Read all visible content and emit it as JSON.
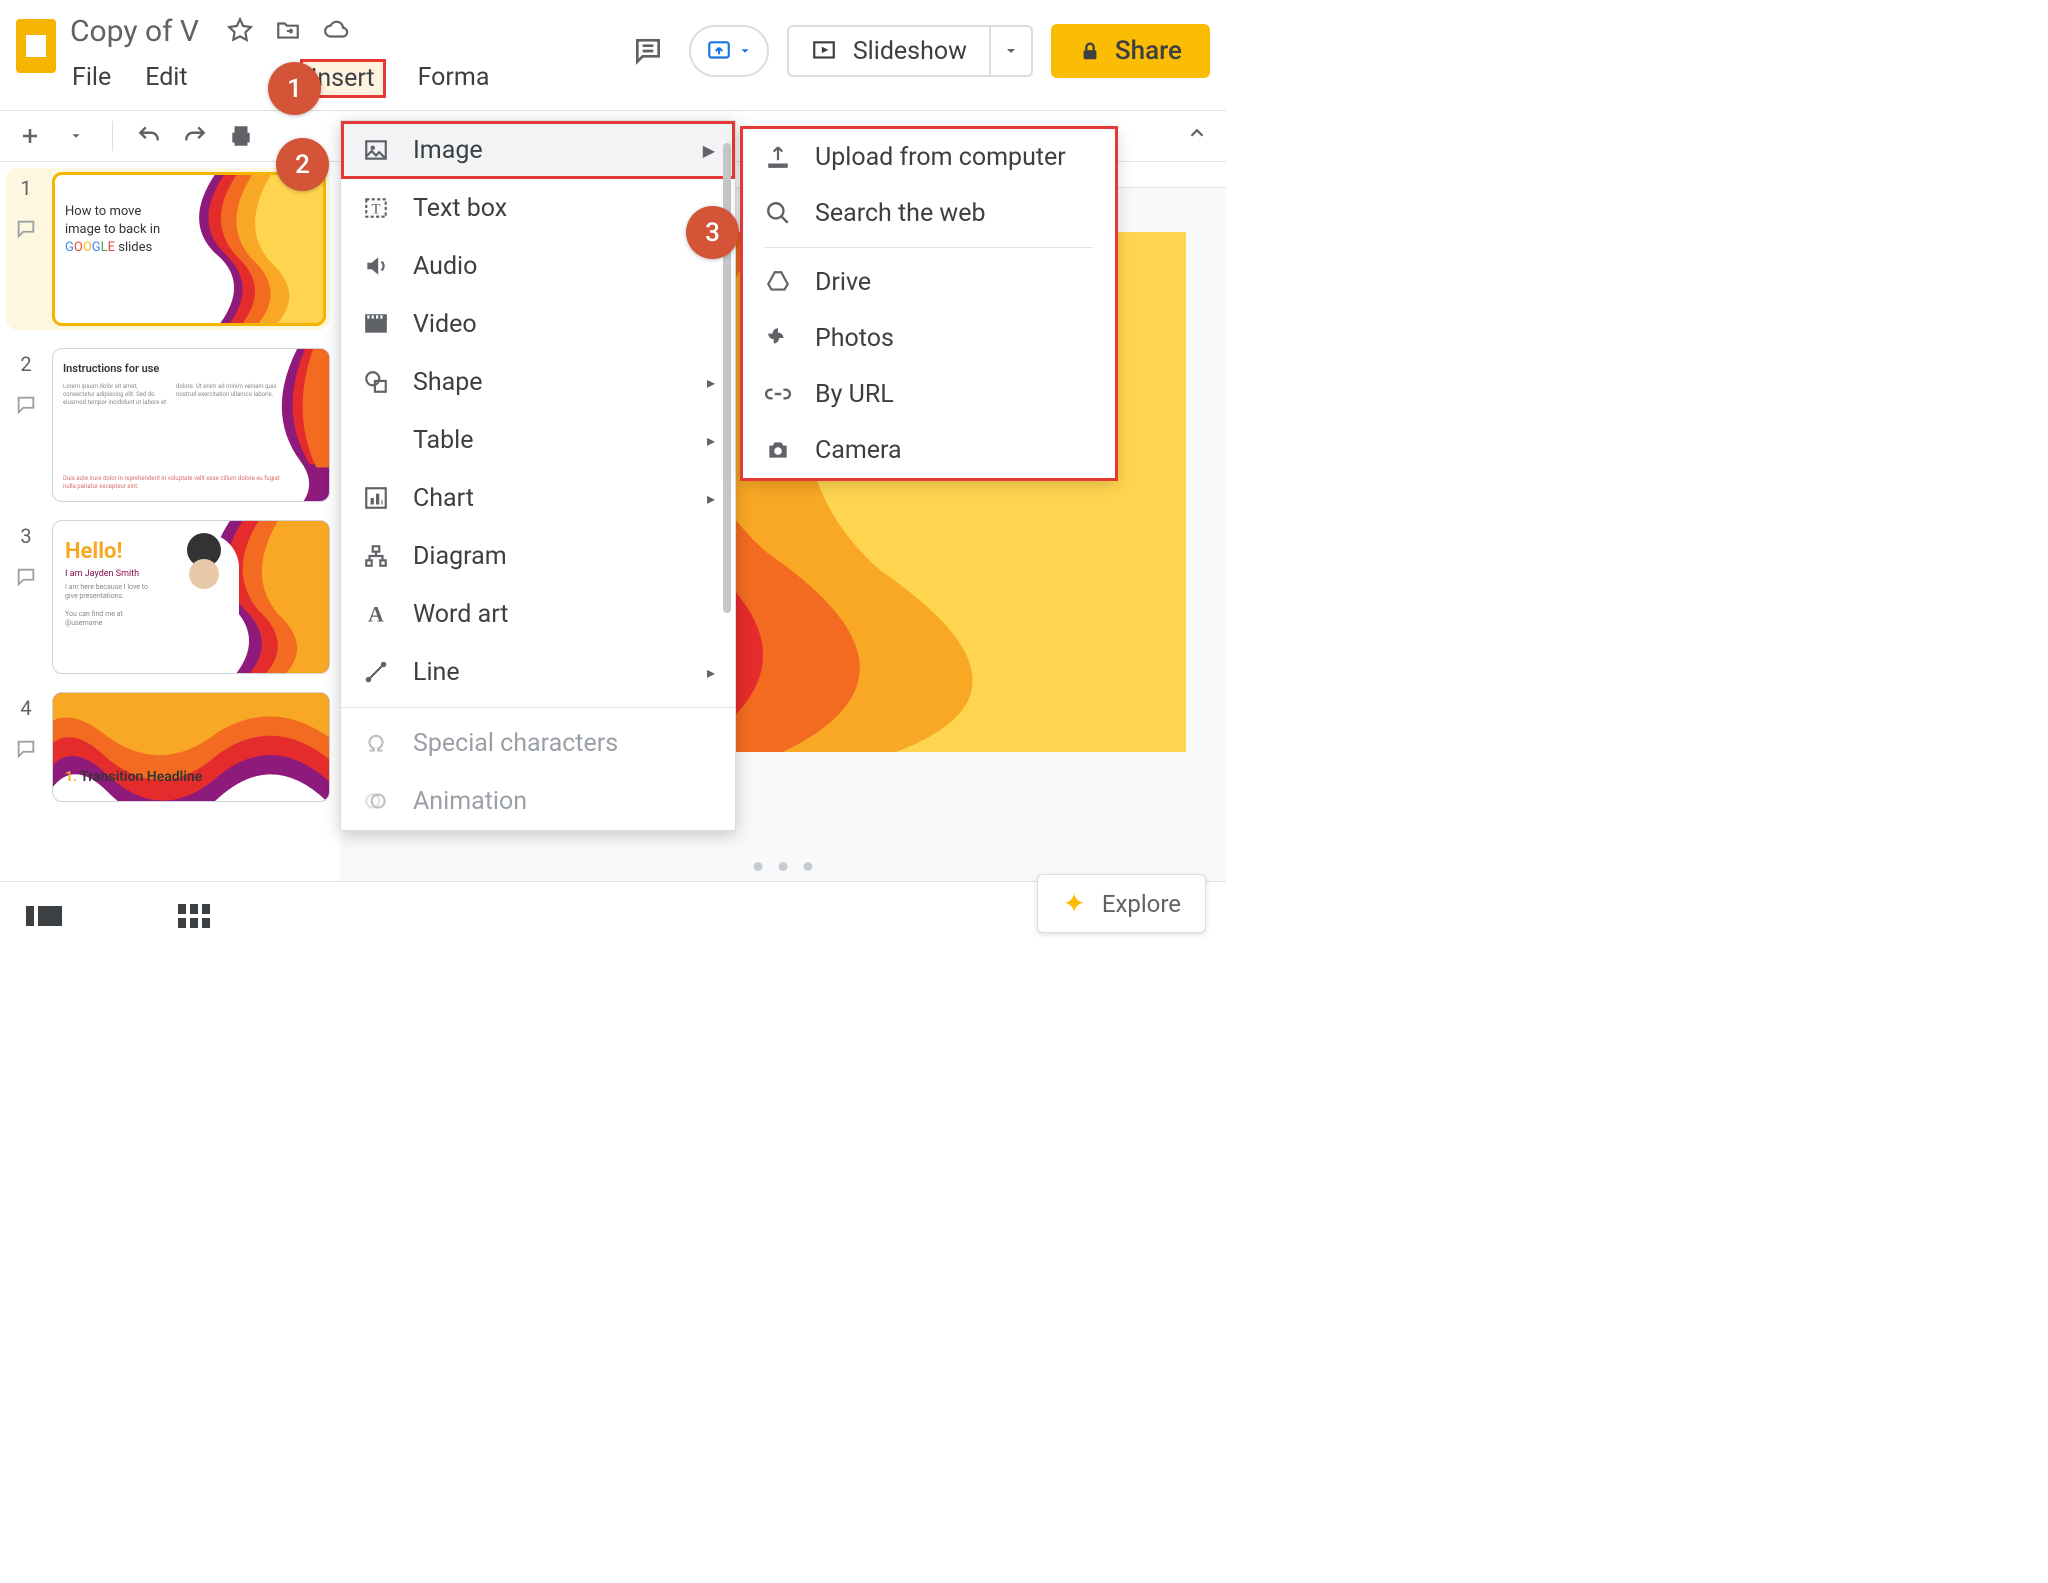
{
  "doc": {
    "title": "Copy of V"
  },
  "menu": {
    "file": "File",
    "edit": "Edit",
    "insert": "Insert",
    "format": "Forma"
  },
  "header_buttons": {
    "slideshow": "Slideshow",
    "share": "Share"
  },
  "sidebar": {
    "slides": [
      {
        "num": "1",
        "line1": "How to move",
        "line2": "image to back in",
        "line3_prefix": "",
        "line3_suffix": " slides"
      },
      {
        "num": "2",
        "title": "Instructions for use"
      },
      {
        "num": "3",
        "hello": "Hello!",
        "sub": "I am Jayden Smith"
      },
      {
        "num": "4",
        "headline_num": "1.",
        "headline": "Transition Headline"
      }
    ]
  },
  "insert_menu": {
    "image": "Image",
    "textbox": "Text box",
    "audio": "Audio",
    "video": "Video",
    "shape": "Shape",
    "table": "Table",
    "chart": "Chart",
    "diagram": "Diagram",
    "wordart": "Word art",
    "line": "Line",
    "special": "Special characters",
    "animation": "Animation"
  },
  "image_submenu": {
    "upload": "Upload from computer",
    "search": "Search the web",
    "drive": "Drive",
    "photos": "Photos",
    "byurl": "By URL",
    "camera": "Camera"
  },
  "explore": {
    "label": "Explore"
  },
  "badges": {
    "b1": "1",
    "b2": "2",
    "b3": "3"
  }
}
